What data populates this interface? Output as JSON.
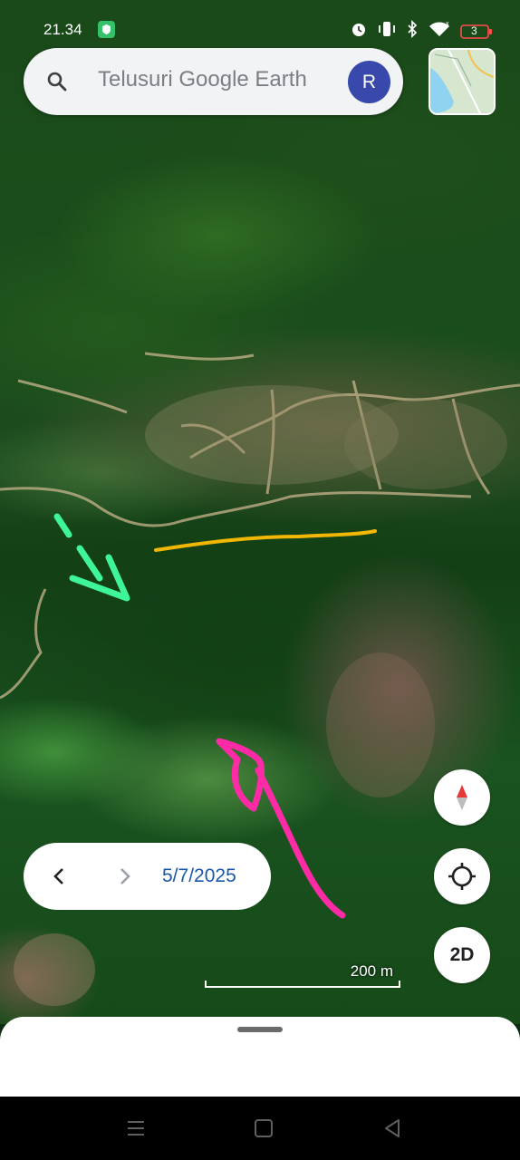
{
  "status_bar": {
    "time": "21.34",
    "battery": "3",
    "icons": [
      "shield-icon",
      "alarm-icon",
      "vibrate-icon",
      "bluetooth-icon",
      "wifi-icon",
      "battery-icon"
    ]
  },
  "search": {
    "placeholder": "Telusuri Google Earth",
    "avatar_letter": "R"
  },
  "map": {
    "annotations": [
      "green-arrow",
      "yellow-line",
      "pink-arrow"
    ],
    "colors": {
      "green_arrow": "#3ff59a",
      "yellow_line": "#f2b705",
      "pink_arrow": "#ff2aa6"
    }
  },
  "timeline": {
    "date": "5/7/2025"
  },
  "controls": {
    "mode_button": "2D"
  },
  "scale": {
    "label": "200 m"
  },
  "colors": {
    "accent": "#3949ab",
    "date_text": "#1a57a8"
  }
}
